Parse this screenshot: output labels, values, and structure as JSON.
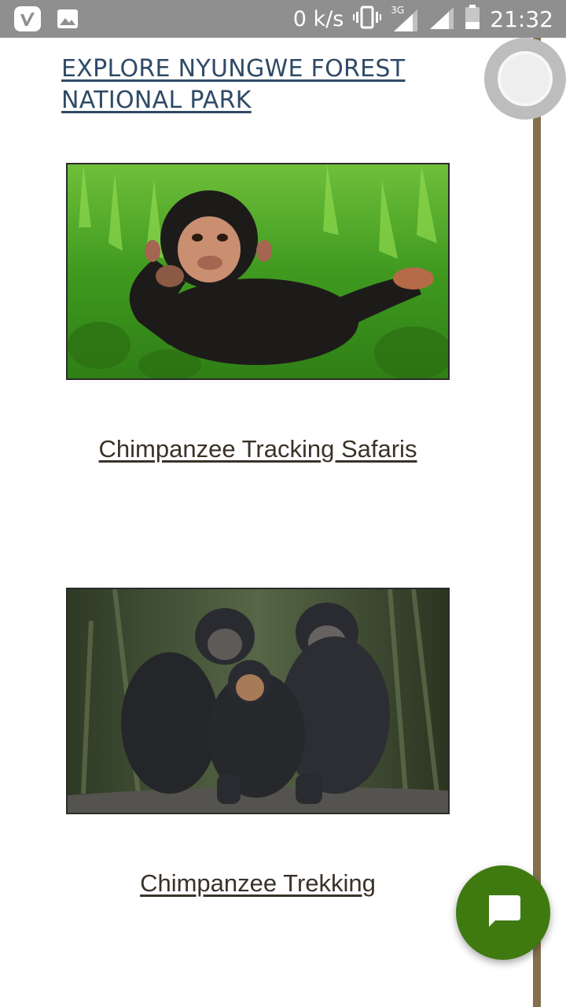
{
  "status_bar": {
    "speed": "0 k/s",
    "network": "3G",
    "time": "21:32",
    "left_icons": [
      "vimeo-icon",
      "image-icon"
    ],
    "right_icons": [
      "vibrate-icon",
      "signal-icon",
      "signal-icon",
      "battery-icon"
    ]
  },
  "page": {
    "title": "EXPLORE NYUNGWE FOREST NATIONAL PARK",
    "accent_color": "#3f7a10",
    "title_color": "#2f4a66"
  },
  "tours": [
    {
      "label": "Chimpanzee Tracking Safaris",
      "image": "chimpanzee-lying-in-grass"
    },
    {
      "label": "Chimpanzee Trekking",
      "image": "chimpanzee-group-on-log"
    }
  ],
  "chat_button": {
    "icon": "chat-bubble-icon"
  }
}
